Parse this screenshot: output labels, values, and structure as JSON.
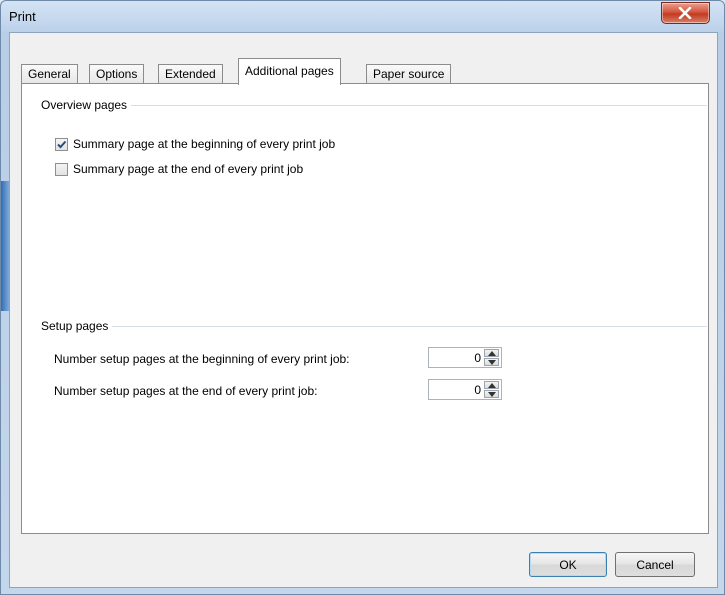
{
  "window": {
    "title": "Print"
  },
  "tabs": [
    {
      "label": "General"
    },
    {
      "label": "Options"
    },
    {
      "label": "Extended"
    },
    {
      "label": "Additional pages",
      "active": true
    },
    {
      "label": "Paper source"
    }
  ],
  "overview": {
    "title": "Overview pages",
    "items": [
      {
        "label": "Summary page at the beginning of every print job",
        "checked": true
      },
      {
        "label": "Summary page at the end of every print job",
        "checked": false
      }
    ]
  },
  "setup": {
    "title": "Setup pages",
    "items": [
      {
        "label": "Number setup pages at the beginning of every print job:",
        "value": "0"
      },
      {
        "label": "Number setup pages at the end of every print job:",
        "value": "0"
      }
    ]
  },
  "buttons": {
    "ok": "OK",
    "cancel": "Cancel"
  },
  "icons": {
    "close": "close-icon",
    "check": "checkmark-icon",
    "up": "arrow-up-icon",
    "down": "arrow-down-icon"
  },
  "colors": {
    "checkmark": "#2a4c7a",
    "close_button": "#c23a1f"
  }
}
